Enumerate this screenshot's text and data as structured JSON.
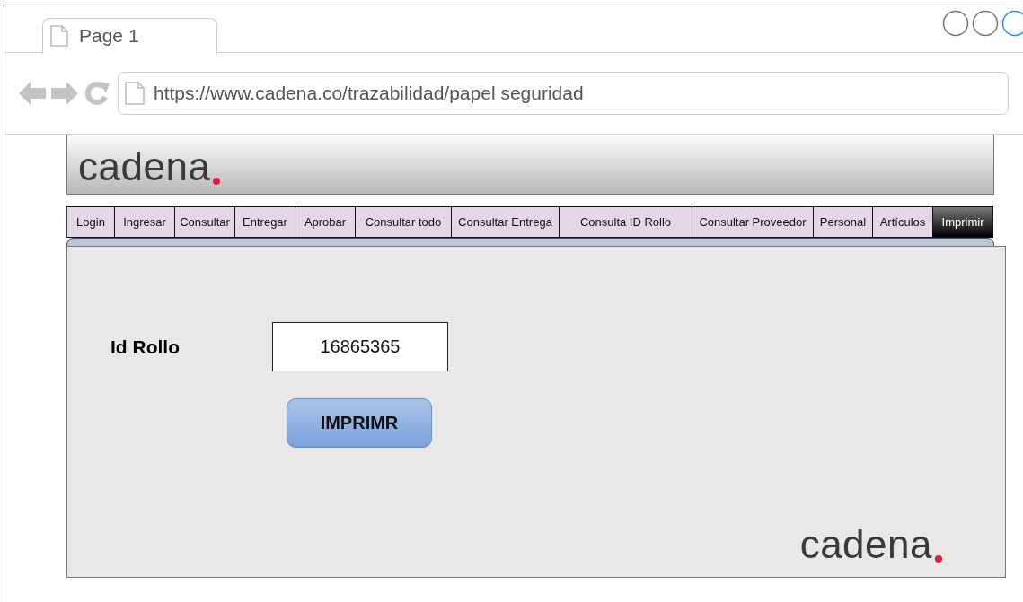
{
  "browser": {
    "tab": {
      "title": "Page 1"
    },
    "url": "https://www.cadena.co/trazabilidad/papel seguridad"
  },
  "header": {
    "logo": "cadena"
  },
  "nav": [
    {
      "label": "Login",
      "selected": false
    },
    {
      "label": "Ingresar",
      "selected": false
    },
    {
      "label": "Consultar",
      "selected": false
    },
    {
      "label": "Entregar",
      "selected": false
    },
    {
      "label": "Aprobar",
      "selected": false
    },
    {
      "label": "Consultar todo",
      "selected": false
    },
    {
      "label": "Consultar Entrega",
      "selected": false
    },
    {
      "label": "Consulta ID Rollo",
      "selected": false
    },
    {
      "label": "Consultar Proveedor",
      "selected": false
    },
    {
      "label": "Personal",
      "selected": false
    },
    {
      "label": "Artículos",
      "selected": false
    },
    {
      "label": "Imprimir",
      "selected": true
    }
  ],
  "form": {
    "label": "Id Rollo",
    "value": "16865365",
    "button": "IMPRIMR"
  },
  "footer": {
    "logo": "cadena"
  }
}
